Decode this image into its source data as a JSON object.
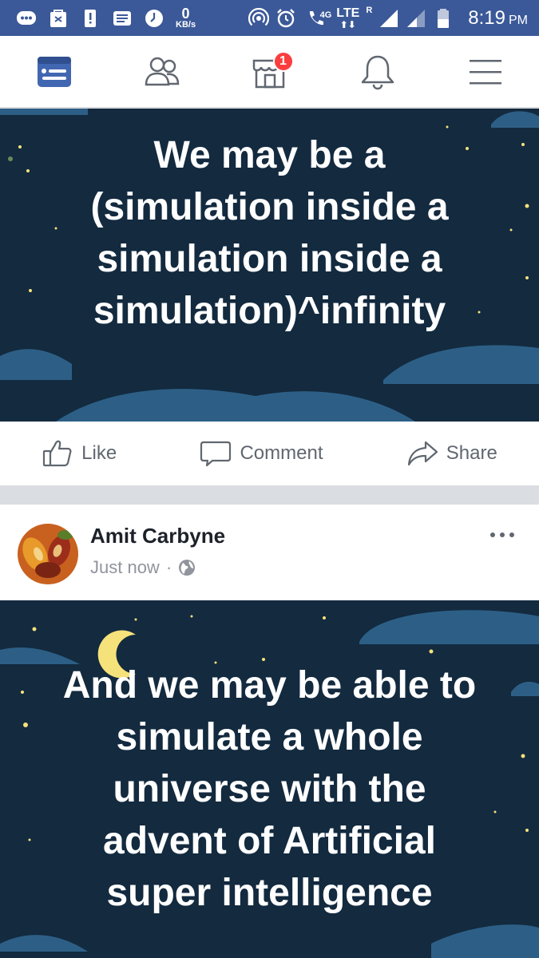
{
  "status_bar": {
    "speed_value": "0",
    "speed_unit": "KB/s",
    "network_label": "4G",
    "lte_label": "LTE",
    "roaming_label": "R",
    "time": "8:19",
    "ampm": "PM",
    "icons": [
      "chat-bubble-icon",
      "shopping-bag-icon",
      "alert-icon",
      "news-icon",
      "clock-icon",
      "hotspot-icon",
      "alarm-icon",
      "wifi-calling-icon",
      "signal-icon",
      "battery-icon"
    ]
  },
  "nav": {
    "items": [
      {
        "name": "news-feed",
        "icon": "news-feed-icon",
        "active": true
      },
      {
        "name": "friends",
        "icon": "friends-icon"
      },
      {
        "name": "marketplace",
        "icon": "marketplace-icon",
        "badge": "1"
      },
      {
        "name": "notifications",
        "icon": "bell-icon"
      },
      {
        "name": "menu",
        "icon": "hamburger-icon"
      }
    ],
    "accent": "#4267b2",
    "badge_color": "#fa3e3e"
  },
  "post1": {
    "lines": [
      "We may be a",
      "(simulation inside a",
      "simulation inside a",
      "simulation)^infinity"
    ]
  },
  "actions": {
    "like": "Like",
    "comment": "Comment",
    "share": "Share"
  },
  "post2": {
    "author": "Amit Carbyne",
    "time": "Just now",
    "separator": "·",
    "privacy_icon": "globe-icon",
    "lines": [
      "And we may be able to",
      "simulate a whole",
      "universe with the",
      "advent of Artificial",
      "super intelligence"
    ]
  },
  "colors": {
    "sky": "#132a3f",
    "cloud": "#2d5f86",
    "status_bar": "#3b5998"
  }
}
